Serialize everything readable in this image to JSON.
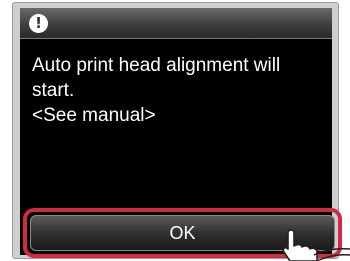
{
  "dialog": {
    "icon": "exclamation-icon",
    "message_lines": [
      "Auto print head alignment will",
      "start.",
      "<See manual>"
    ],
    "ok_label": "OK"
  },
  "colors": {
    "screen_background": "#000000",
    "text": "#ffffff",
    "highlight": "#d12a43"
  },
  "overlay": {
    "pointer_icon": "tapping-finger-icon"
  }
}
